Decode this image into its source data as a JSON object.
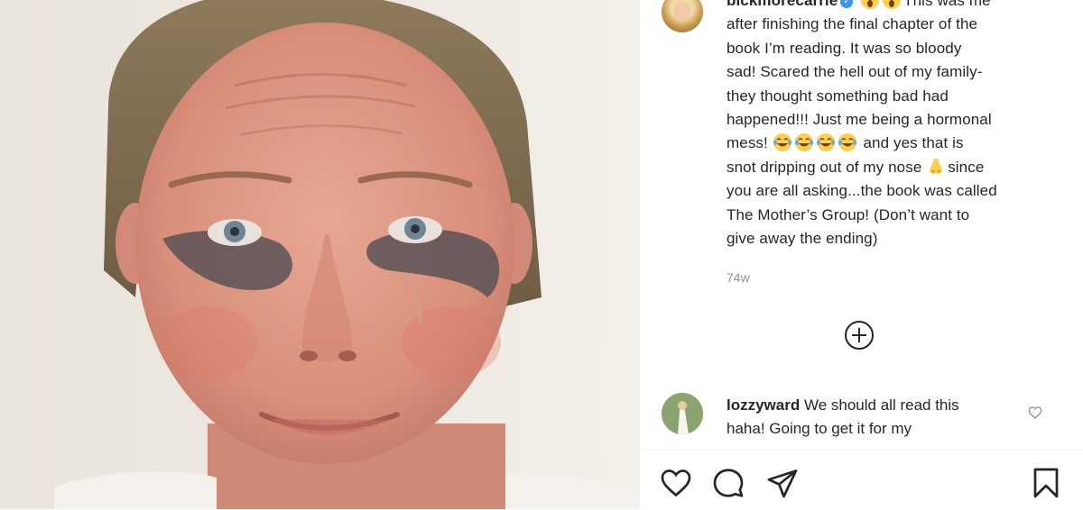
{
  "post": {
    "username": "bickmorecarrie",
    "caption_lines": [
      "This was me",
      "after finishing the final chapter of the",
      "book I’m reading. It was so bloody",
      "sad! Scared the hell out of my family-",
      "they thought something bad had",
      "happened!!! Just me being a hormonal",
      "mess!",
      " and yes that is",
      "snot dripping out of my nose",
      "since",
      "you are all asking...the book was called",
      "The Mother’s Group! (Don’t want to",
      "give away the ending)"
    ],
    "timestamp": "74w"
  },
  "comments": [
    {
      "username": "lozzyward",
      "text": "We should all read this",
      "text_line2": "haha! Going to get it for my"
    }
  ],
  "icons": {
    "verified": "verified-badge-icon",
    "load_more": "plus-circle-icon",
    "like": "heart-icon",
    "comment": "comment-bubble-icon",
    "share": "paper-plane-icon",
    "save": "bookmark-icon",
    "comment_like": "small-heart-icon"
  },
  "colors": {
    "text": "#262626",
    "muted": "#8e8e8e",
    "verified_blue": "#3897f0",
    "divider": "#efefef"
  }
}
